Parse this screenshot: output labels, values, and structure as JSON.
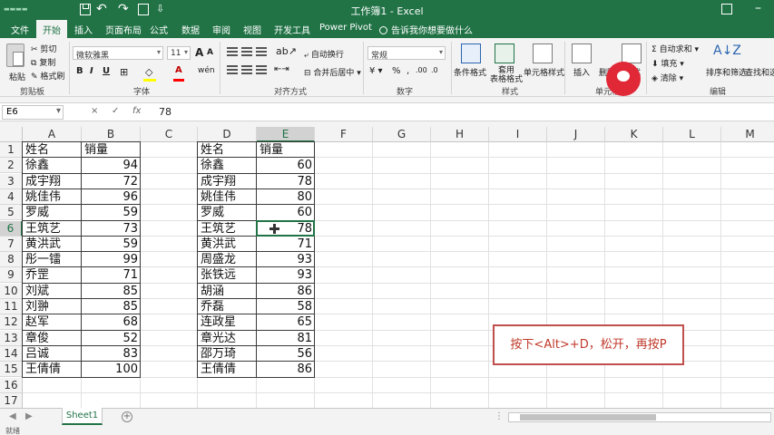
{
  "window": {
    "title": "工作簿1 - Excel"
  },
  "tabs": [
    "文件",
    "开始",
    "插入",
    "页面布局",
    "公式",
    "数据",
    "审阅",
    "视图",
    "开发工具",
    "Power Pivot"
  ],
  "tell_me": "告诉我你想要做什么",
  "ribbon": {
    "clipboard": {
      "paste": "粘贴",
      "cut": "剪切",
      "copy": "复制",
      "format_painter": "格式刷",
      "label": "剪贴板"
    },
    "font": {
      "name": "微软雅黑",
      "size": "11",
      "bold": "B",
      "italic": "I",
      "underline": "U",
      "grow": "A",
      "shrink": "A",
      "label": "字体"
    },
    "alignment": {
      "wrap": "自动换行",
      "merge": "合并后居中",
      "label": "对齐方式"
    },
    "number": {
      "format": "常规",
      "label": "数字"
    },
    "styles": {
      "conditional": "条件格式",
      "table": "套用\n表格格式",
      "cell_styles": "单元格样式",
      "label": "样式"
    },
    "cells": {
      "insert": "插入",
      "delete": "删除",
      "format": "格式",
      "label": "单元格"
    },
    "editing": {
      "autosum": "自动求和",
      "fill": "填充",
      "clear": "清除",
      "sort": "排序和筛选",
      "find": "查找和选择",
      "label": "编辑"
    }
  },
  "formula_bar": {
    "name_box": "E6",
    "cancel": "×",
    "enter": "✓",
    "fx": "fx",
    "value": "78"
  },
  "columns": [
    "A",
    "B",
    "C",
    "D",
    "E",
    "F",
    "G",
    "H",
    "I",
    "J",
    "K",
    "L",
    "M"
  ],
  "rows": [
    "1",
    "2",
    "3",
    "4",
    "5",
    "6",
    "7",
    "8",
    "9",
    "10",
    "11",
    "12",
    "13",
    "14",
    "15",
    "16",
    "17"
  ],
  "table1": {
    "headers": [
      "姓名",
      "销量"
    ],
    "rows": [
      [
        "徐鑫",
        "94"
      ],
      [
        "成宇翔",
        "72"
      ],
      [
        "姚佳伟",
        "96"
      ],
      [
        "罗威",
        "59"
      ],
      [
        "王筑艺",
        "73"
      ],
      [
        "黄洪武",
        "59"
      ],
      [
        "彤一镭",
        "99"
      ],
      [
        "乔罡",
        "71"
      ],
      [
        "刘斌",
        "85"
      ],
      [
        "刘翀",
        "85"
      ],
      [
        "赵军",
        "68"
      ],
      [
        "章俊",
        "52"
      ],
      [
        "吕诚",
        "83"
      ],
      [
        "王倩倩",
        "100"
      ]
    ]
  },
  "table2": {
    "headers": [
      "姓名",
      "销量"
    ],
    "rows": [
      [
        "徐鑫",
        "60"
      ],
      [
        "成宇翔",
        "78"
      ],
      [
        "姚佳伟",
        "80"
      ],
      [
        "罗威",
        "60"
      ],
      [
        "王筑艺",
        "78"
      ],
      [
        "黄洪武",
        "71"
      ],
      [
        "周盛龙",
        "93"
      ],
      [
        "张铁远",
        "93"
      ],
      [
        "胡涵",
        "86"
      ],
      [
        "乔磊",
        "58"
      ],
      [
        "连政星",
        "65"
      ],
      [
        "章光达",
        "81"
      ],
      [
        "邵万琦",
        "56"
      ],
      [
        "王倩倩",
        "86"
      ]
    ]
  },
  "note": "按下<Alt>+D，松开，再按P",
  "sheet_tab": "Sheet1",
  "status": {
    "ready": "就绪"
  },
  "colors": {
    "excel_green": "#217346",
    "note_red": "#c0504d"
  }
}
